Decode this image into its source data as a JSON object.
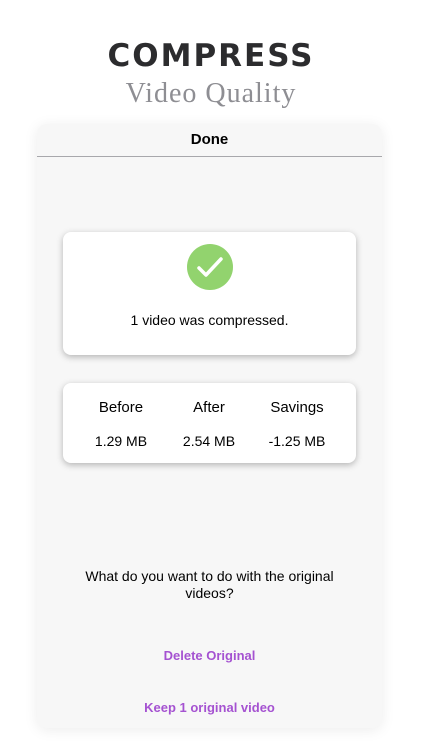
{
  "hero": {
    "title": "COMPRESS",
    "subtitle": "Video Quality"
  },
  "navbar": {
    "title": "Done"
  },
  "success_card": {
    "icon": "checkmark-circle-icon",
    "icon_color": "#92d36e",
    "message": "1 video was compressed."
  },
  "stats": {
    "columns": [
      {
        "label": "Before",
        "value": "1.29 MB"
      },
      {
        "label": "After",
        "value": "2.54 MB"
      },
      {
        "label": "Savings",
        "value": "-1.25 MB"
      }
    ]
  },
  "prompt": {
    "question": "What do you want to do with the original videos?"
  },
  "actions": {
    "delete_label": "Delete Original",
    "keep_label": "Keep 1 original video",
    "accent_color": "#a552d1"
  }
}
